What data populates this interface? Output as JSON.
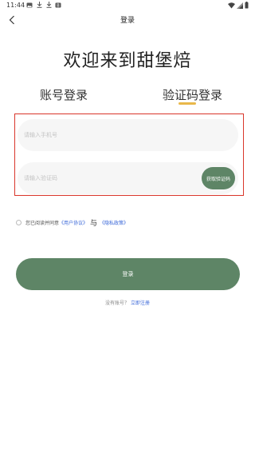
{
  "status_bar": {
    "time": "11:44",
    "left_icons": [
      "image-icon",
      "download-icon",
      "download-icon",
      "app-icon"
    ],
    "right_icons": [
      "wifi-icon",
      "signal-icon",
      "battery-icon"
    ]
  },
  "nav": {
    "title": "登录"
  },
  "welcome_text": "欢迎来到甜堡焙",
  "tabs": {
    "account_login": "账号登录",
    "code_login": "验证码登录",
    "active": "code_login"
  },
  "form": {
    "phone_placeholder": "请输入手机号",
    "phone_value": "",
    "code_placeholder": "请输入验证码",
    "code_value": "",
    "get_code_label": "获取验证码"
  },
  "agreement": {
    "prefix": "您已阅读并同意",
    "user_agreement": "《用户协议》",
    "and": "与",
    "privacy_policy": "《隐私政策》",
    "checked": false
  },
  "login_button": "登录",
  "register": {
    "prompt": "没有账号？",
    "link": "立即注册"
  },
  "colors": {
    "primary": "#5e8566",
    "accent_underline": "#e9b84a",
    "link": "#3a67d8",
    "highlight_frame": "#d9362b"
  }
}
